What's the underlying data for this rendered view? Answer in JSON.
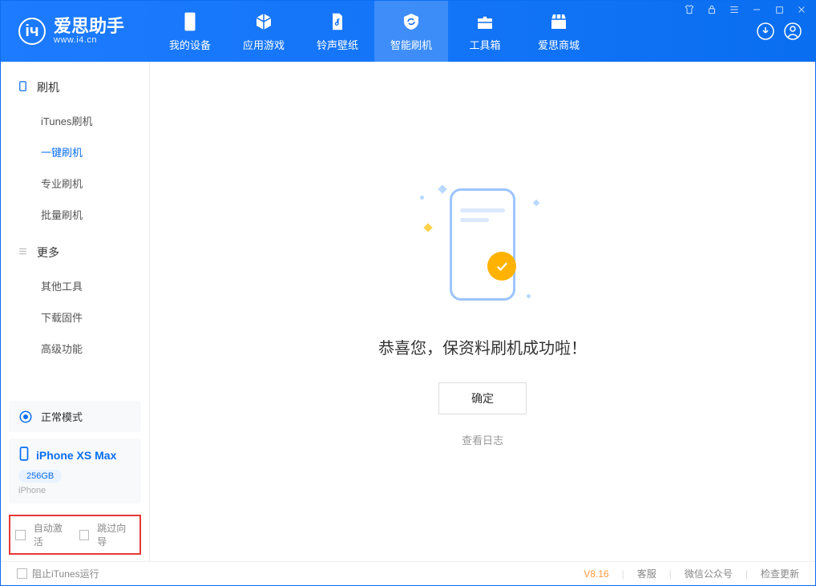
{
  "app": {
    "logo_text": "爱思助手",
    "logo_sub": "www.i4.cn"
  },
  "tabs": {
    "device": "我的设备",
    "apps": "应用游戏",
    "ringtones": "铃声壁纸",
    "flash": "智能刷机",
    "toolbox": "工具箱",
    "store": "爱思商城"
  },
  "sidebar": {
    "section_flash": "刷机",
    "items": {
      "itunes": "iTunes刷机",
      "oneclick": "一键刷机",
      "pro": "专业刷机",
      "batch": "批量刷机"
    },
    "section_more": "更多",
    "more_items": {
      "other_tools": "其他工具",
      "download_fw": "下载固件",
      "advanced": "高级功能"
    }
  },
  "device_status": {
    "mode": "正常模式",
    "name": "iPhone XS Max",
    "storage": "256GB",
    "type": "iPhone"
  },
  "checkboxes": {
    "auto_activate": "自动激活",
    "skip_guide": "跳过向导"
  },
  "main": {
    "title": "恭喜您，保资料刷机成功啦！",
    "confirm": "确定",
    "view_log": "查看日志"
  },
  "footer": {
    "block_itunes": "阻止iTunes运行",
    "version": "V8.16",
    "support": "客服",
    "wechat": "微信公众号",
    "check_update": "检查更新"
  }
}
